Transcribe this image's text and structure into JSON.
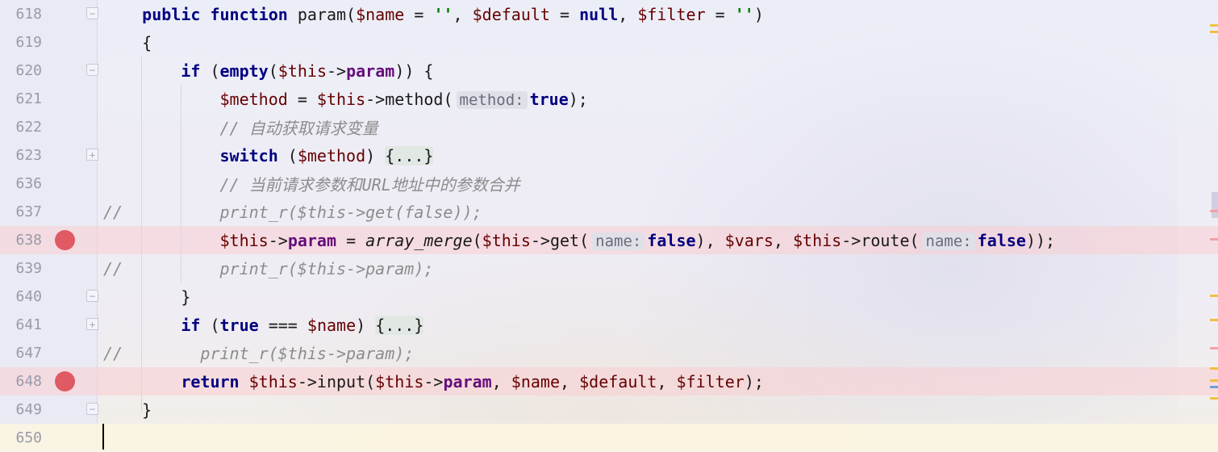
{
  "editor": {
    "lines": [
      {
        "num": "618",
        "tokens": [
          {
            "t": "    ",
            "c": ""
          },
          {
            "t": "public",
            "c": "kw"
          },
          {
            "t": " ",
            "c": ""
          },
          {
            "t": "function",
            "c": "kw"
          },
          {
            "t": " param(",
            "c": ""
          },
          {
            "t": "$name",
            "c": "var"
          },
          {
            "t": " = ",
            "c": ""
          },
          {
            "t": "''",
            "c": "str"
          },
          {
            "t": ", ",
            "c": ""
          },
          {
            "t": "$default",
            "c": "var"
          },
          {
            "t": " = ",
            "c": ""
          },
          {
            "t": "null",
            "c": "kw"
          },
          {
            "t": ", ",
            "c": ""
          },
          {
            "t": "$filter",
            "c": "var"
          },
          {
            "t": " = ",
            "c": ""
          },
          {
            "t": "''",
            "c": "str"
          },
          {
            "t": ")",
            "c": ""
          }
        ]
      },
      {
        "num": "619",
        "tokens": [
          {
            "t": "    {",
            "c": ""
          }
        ]
      },
      {
        "num": "620",
        "tokens": [
          {
            "t": "        ",
            "c": ""
          },
          {
            "t": "if",
            "c": "kw"
          },
          {
            "t": " (",
            "c": ""
          },
          {
            "t": "empty",
            "c": "kw"
          },
          {
            "t": "(",
            "c": ""
          },
          {
            "t": "$this",
            "c": "var"
          },
          {
            "t": "->",
            "c": ""
          },
          {
            "t": "param",
            "c": "prop"
          },
          {
            "t": ")) {",
            "c": ""
          }
        ]
      },
      {
        "num": "621",
        "tokens": [
          {
            "t": "            ",
            "c": ""
          },
          {
            "t": "$method",
            "c": "var"
          },
          {
            "t": " = ",
            "c": ""
          },
          {
            "t": "$this",
            "c": "var"
          },
          {
            "t": "->method(",
            "c": ""
          },
          {
            "t": "method:",
            "c": "hint"
          },
          {
            "t": "true",
            "c": "kw"
          },
          {
            "t": ");",
            "c": ""
          }
        ]
      },
      {
        "num": "622",
        "tokens": [
          {
            "t": "            ",
            "c": ""
          },
          {
            "t": "// 自动获取请求变量",
            "c": "cm"
          }
        ]
      },
      {
        "num": "623",
        "tokens": [
          {
            "t": "            ",
            "c": ""
          },
          {
            "t": "switch",
            "c": "kw"
          },
          {
            "t": " (",
            "c": ""
          },
          {
            "t": "$method",
            "c": "var"
          },
          {
            "t": ") ",
            "c": ""
          },
          {
            "t": "{...}",
            "c": "folded"
          }
        ]
      },
      {
        "num": "636",
        "tokens": [
          {
            "t": "            ",
            "c": ""
          },
          {
            "t": "// 当前请求参数和URL地址中的参数合并",
            "c": "cm"
          }
        ]
      },
      {
        "num": "637",
        "tokens": [
          {
            "t": "//          print_r($this->get(false));",
            "c": "cm"
          }
        ]
      },
      {
        "num": "638",
        "tokens": [
          {
            "t": "            ",
            "c": ""
          },
          {
            "t": "$this",
            "c": "var"
          },
          {
            "t": "->",
            "c": ""
          },
          {
            "t": "param",
            "c": "prop"
          },
          {
            "t": " = ",
            "c": ""
          },
          {
            "t": "array_merge",
            "c": "fn-it"
          },
          {
            "t": "(",
            "c": ""
          },
          {
            "t": "$this",
            "c": "var"
          },
          {
            "t": "->get(",
            "c": ""
          },
          {
            "t": "name:",
            "c": "hint"
          },
          {
            "t": "false",
            "c": "kw"
          },
          {
            "t": "), ",
            "c": ""
          },
          {
            "t": "$vars",
            "c": "var"
          },
          {
            "t": ", ",
            "c": ""
          },
          {
            "t": "$this",
            "c": "var"
          },
          {
            "t": "->route(",
            "c": ""
          },
          {
            "t": "name:",
            "c": "hint"
          },
          {
            "t": "false",
            "c": "kw"
          },
          {
            "t": "));",
            "c": ""
          }
        ]
      },
      {
        "num": "639",
        "tokens": [
          {
            "t": "//          print_r($this->param);",
            "c": "cm"
          }
        ]
      },
      {
        "num": "640",
        "tokens": [
          {
            "t": "        }",
            "c": ""
          }
        ]
      },
      {
        "num": "641",
        "tokens": [
          {
            "t": "        ",
            "c": ""
          },
          {
            "t": "if",
            "c": "kw"
          },
          {
            "t": " (",
            "c": ""
          },
          {
            "t": "true",
            "c": "kw"
          },
          {
            "t": " === ",
            "c": ""
          },
          {
            "t": "$name",
            "c": "var"
          },
          {
            "t": ") ",
            "c": ""
          },
          {
            "t": "{...}",
            "c": "folded"
          }
        ]
      },
      {
        "num": "647",
        "tokens": [
          {
            "t": "//        print_r($this->param);",
            "c": "cm"
          }
        ]
      },
      {
        "num": "648",
        "tokens": [
          {
            "t": "        ",
            "c": ""
          },
          {
            "t": "return",
            "c": "kw"
          },
          {
            "t": " ",
            "c": ""
          },
          {
            "t": "$this",
            "c": "var"
          },
          {
            "t": "->input(",
            "c": ""
          },
          {
            "t": "$this",
            "c": "var"
          },
          {
            "t": "->",
            "c": ""
          },
          {
            "t": "param",
            "c": "prop"
          },
          {
            "t": ", ",
            "c": ""
          },
          {
            "t": "$name",
            "c": "var"
          },
          {
            "t": ", ",
            "c": ""
          },
          {
            "t": "$default",
            "c": "var"
          },
          {
            "t": ", ",
            "c": ""
          },
          {
            "t": "$filter",
            "c": "var"
          },
          {
            "t": ");",
            "c": ""
          }
        ]
      },
      {
        "num": "649",
        "tokens": [
          {
            "t": "    }",
            "c": ""
          }
        ]
      },
      {
        "num": "650",
        "tokens": []
      }
    ],
    "breakpoint_lines": [
      "638",
      "648"
    ],
    "current_line": "650",
    "fold_markers": {
      "618": "open",
      "620": "open",
      "623": "plus",
      "640": "close",
      "641": "plus",
      "649": "close"
    },
    "colors": {
      "breakpoint": "#e05a63",
      "keyword": "#000080",
      "variable": "#660000",
      "property": "#660e7a",
      "string": "#008000",
      "comment": "#8c8c8c"
    }
  }
}
